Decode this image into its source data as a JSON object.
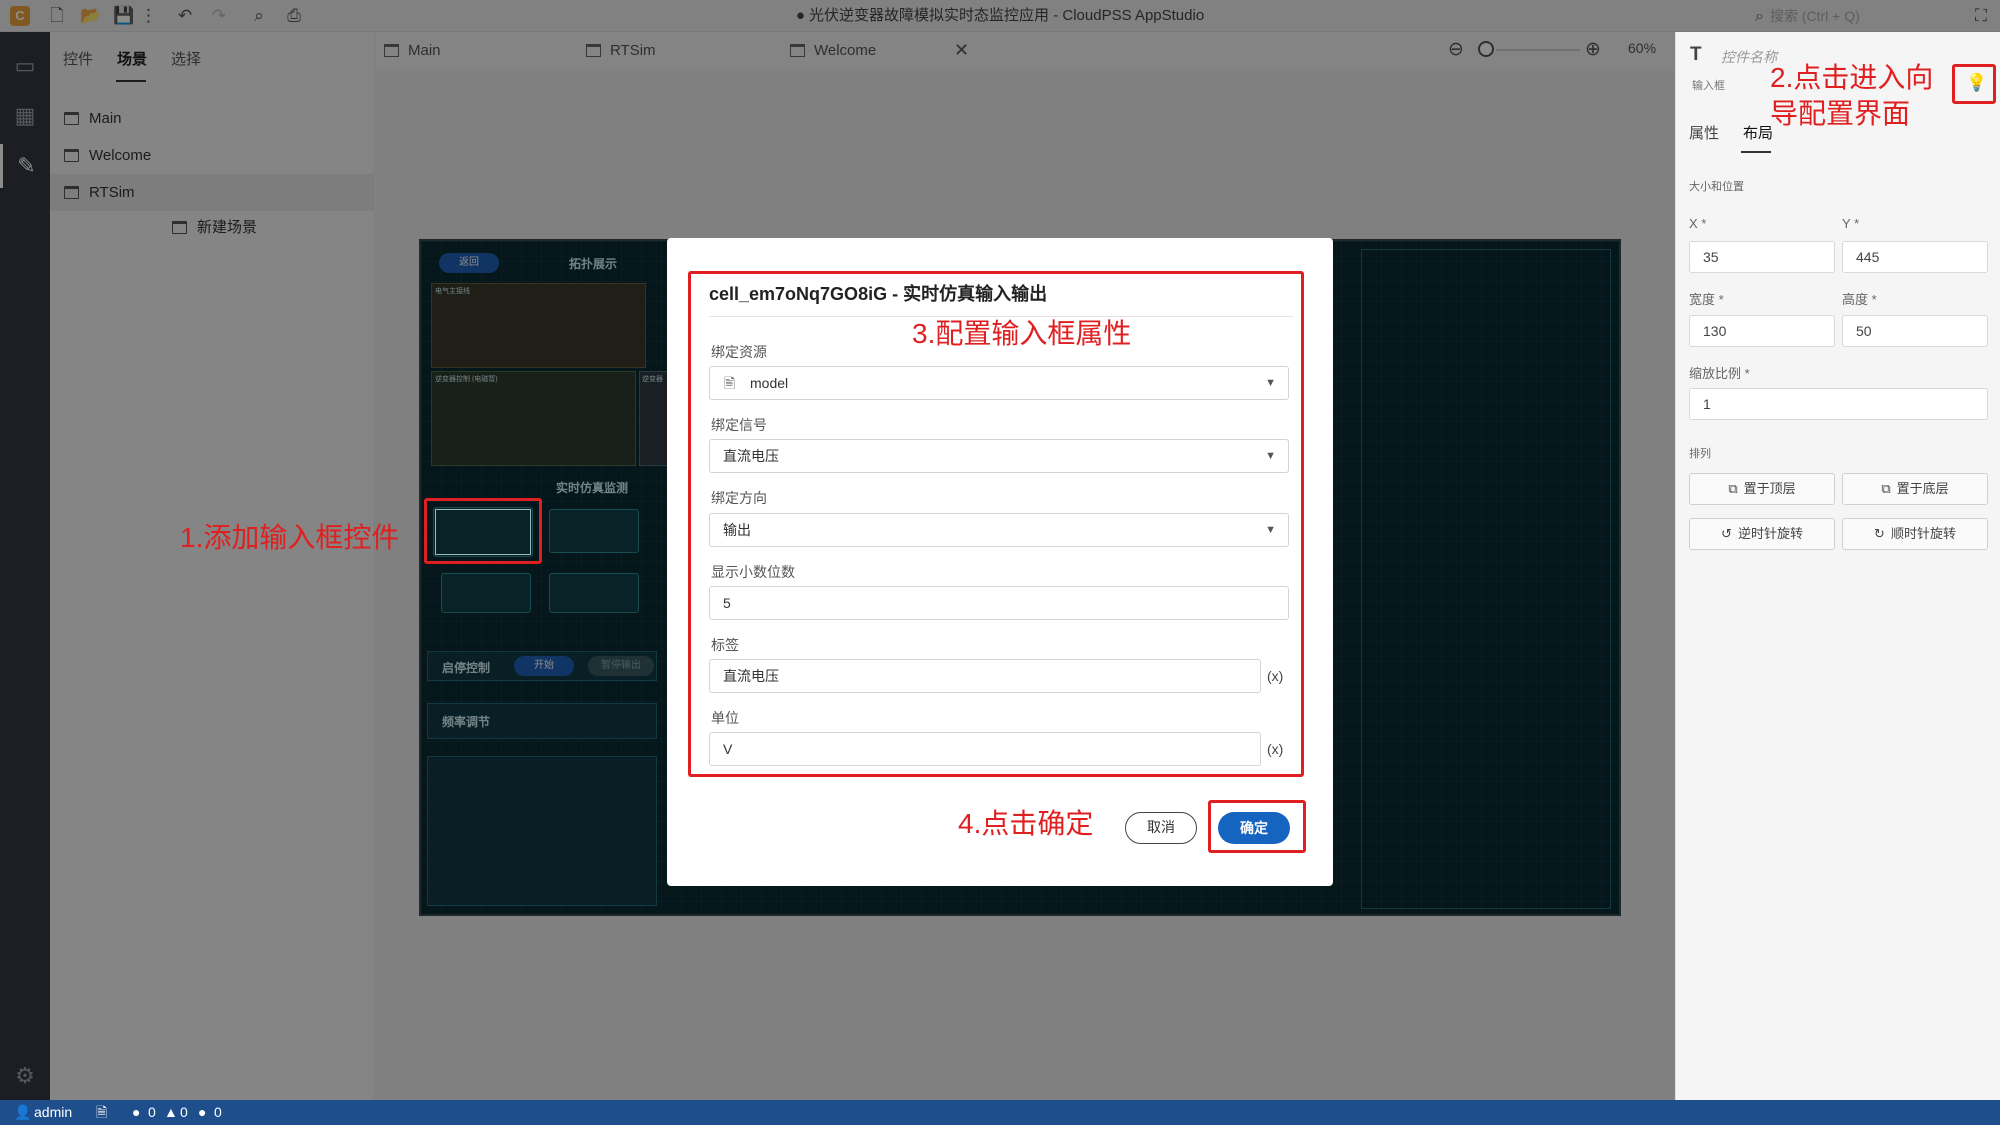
{
  "app": {
    "window_title": "● 光伏逆变器故障模拟实时态监控应用 - CloudPSS AppStudio",
    "search_placeholder": "搜索 (Ctrl + Q)"
  },
  "left_panel": {
    "tabs": [
      "控件",
      "场景",
      "选择"
    ],
    "active_tab": "场景",
    "tree": [
      "Main",
      "Welcome",
      "RTSim"
    ],
    "new_scene": "新建场景"
  },
  "doc_tabs": [
    {
      "label": "Main"
    },
    {
      "label": "RTSim",
      "closable": true
    },
    {
      "label": "Welcome"
    }
  ],
  "zoom": {
    "value": "60%"
  },
  "scene": {
    "top_pill": "返回",
    "topology_title": "拓扑展示",
    "sub1": "电气主接线",
    "sub2": "逆变器控制 (电磁暂)",
    "sub3": "逆变器",
    "monitor_title": "实时仿真监测",
    "start_stop": "启停控制",
    "start_btn": "开始",
    "pause_btn": "暂停输出",
    "freq": "频率调节"
  },
  "modal": {
    "title": "cell_em7oNq7GO8iG - 实时仿真输入输出",
    "fields": {
      "resource": {
        "label": "绑定资源",
        "value": "model"
      },
      "signal": {
        "label": "绑定信号",
        "value": "直流电压"
      },
      "direction": {
        "label": "绑定方向",
        "value": "输出"
      },
      "decimals": {
        "label": "显示小数位数",
        "value": "5"
      },
      "tag": {
        "label": "标签",
        "value": "直流电压"
      },
      "unit": {
        "label": "单位",
        "value": "V"
      }
    },
    "expr_marker": "(x)",
    "cancel": "取消",
    "ok": "确定"
  },
  "annotations": {
    "step1": "1.添加输入框控件",
    "step2_line1": "2.点击进入向",
    "step2_line2": "导配置界面",
    "step3": "3.配置输入框属性",
    "step4": "4.点击确定"
  },
  "right_panel": {
    "control_name_placeholder": "控件名称",
    "control_type": "输入框",
    "tabs": [
      "属性",
      "布局"
    ],
    "active_tab": "布局",
    "section_size": "大小和位置",
    "x_label": "X",
    "x_value": "35",
    "y_label": "Y",
    "y_value": "445",
    "width_label": "宽度",
    "width_value": "130",
    "height_label": "高度",
    "height_value": "50",
    "scale_label": "缩放比例",
    "scale_value": "1",
    "arrange_label": "排列",
    "bring_top": "置于顶层",
    "send_bottom": "置于底层",
    "rotate_ccw": "逆时针旋转",
    "rotate_cw": "顺时针旋转",
    "required_mark": "*"
  },
  "statusbar": {
    "user": "admin",
    "errors": "0",
    "warnings": "0",
    "infos": "0"
  }
}
